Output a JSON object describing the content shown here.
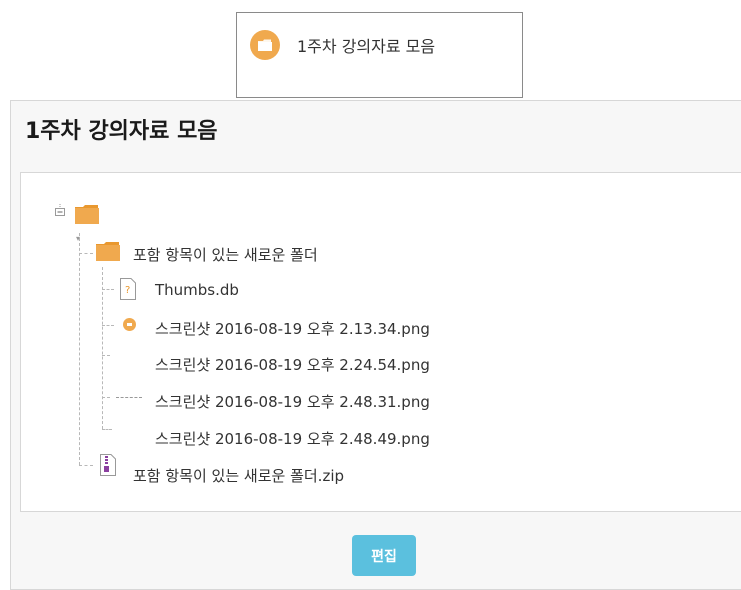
{
  "activity_card": {
    "icon": "folder-icon",
    "label": "1주차 강의자료 모음"
  },
  "panel": {
    "title": "1주차 강의자료 모음",
    "tree": {
      "root_icon": "folder-icon",
      "folder": {
        "label": "포함 항목이 있는 새로운 폴더",
        "icon": "folder-icon",
        "files": [
          {
            "name": "Thumbs.db",
            "icon": "unknown-file-icon"
          },
          {
            "name": "스크린샷 2016-08-19 오후 2.13.34.png",
            "icon": "image-file-icon"
          },
          {
            "name": "스크린샷 2016-08-19 오후 2.24.54.png",
            "icon": ""
          },
          {
            "name": "스크린샷 2016-08-19 오후 2.48.31.png",
            "icon": ""
          },
          {
            "name": "스크린샷 2016-08-19 오후 2.48.49.png",
            "icon": ""
          }
        ]
      },
      "zip_file": {
        "name": "포함 항목이 있는 새로운 폴더.zip",
        "icon": "zip-file-icon"
      }
    },
    "edit_button_label": "편집"
  },
  "colors": {
    "folder": "#f0a94e",
    "edit_button": "#5bc0de",
    "border": "#d7d7d7"
  }
}
